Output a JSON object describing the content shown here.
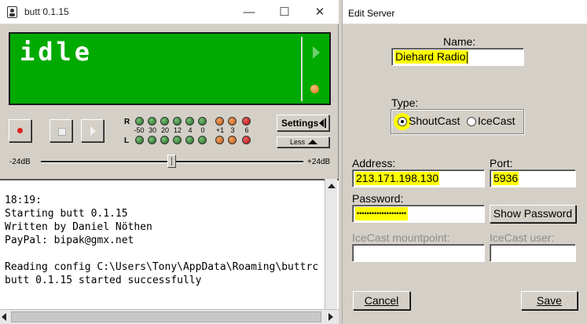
{
  "main_window": {
    "title": "butt 0.1.15",
    "controls": {
      "minimize": "—",
      "maximize": "☐",
      "close": "✕"
    },
    "display": {
      "status_text": "idle"
    },
    "vu_meter": {
      "right_label": "R",
      "left_label": "L",
      "ticks": [
        "-50",
        "30",
        "20",
        "12",
        "4",
        "0",
        "+1",
        "3",
        "6"
      ]
    },
    "settings_label": "Settings",
    "less_label": "Less",
    "gain_min": "-24dB",
    "gain_max": "+24dB",
    "log_lines": [
      "18:19:",
      "Starting butt 0.1.15",
      "Written by Daniel Nöthen",
      "PayPal: bipak@gmx.net",
      "",
      "Reading config C:\\Users\\Tony\\AppData\\Roaming\\buttrc",
      "butt 0.1.15 started successfully"
    ]
  },
  "edit_server": {
    "title": "Edit Server",
    "name_label": "Name:",
    "name_value": "Diehard Radio",
    "type_label": "Type:",
    "type_options": [
      "ShoutCast",
      "IceCast"
    ],
    "type_selected": "ShoutCast",
    "address_label": "Address:",
    "address_value": "213.171.198.130",
    "port_label": "Port:",
    "port_value": "5936",
    "password_label": "Password:",
    "password_masked": "••••••••••••••••••••",
    "show_password_label": "Show Password",
    "mountpoint_label": "IceCast mountpoint:",
    "user_label": "IceCast user:",
    "cancel_label": "Cancel",
    "save_label": "Save"
  },
  "colors": {
    "display_bg": "#00aa00",
    "highlight": "#ffff00",
    "window_bg": "#d4d0c8"
  }
}
